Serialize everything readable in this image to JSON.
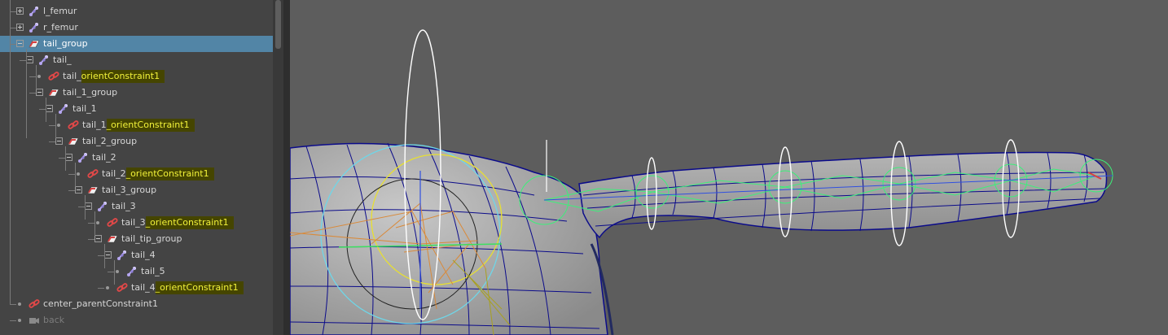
{
  "outliner": {
    "items": [
      {
        "name": "l_femur",
        "suffix": "",
        "icon": "joint-icon",
        "expander": "plus"
      },
      {
        "name": "r_femur",
        "suffix": "",
        "icon": "joint-icon",
        "expander": "plus"
      },
      {
        "name": "tail_group",
        "suffix": "",
        "icon": "transform-group-icon",
        "expander": "minus",
        "selected": true
      },
      {
        "name": "tail_",
        "suffix": "",
        "icon": "joint-icon",
        "expander": "minus"
      },
      {
        "name": "tail_",
        "suffix": "orientConstraint1",
        "icon": "constraint-icon",
        "expander": "none"
      },
      {
        "name": "tail_1_group",
        "suffix": "",
        "icon": "transform-group-icon",
        "expander": "minus"
      },
      {
        "name": "tail_1",
        "suffix": "",
        "icon": "joint-icon",
        "expander": "minus"
      },
      {
        "name": "tail_1",
        "suffix": "_orientConstraint1",
        "icon": "constraint-icon",
        "expander": "none"
      },
      {
        "name": "tail_2_group",
        "suffix": "",
        "icon": "transform-group-icon",
        "expander": "minus"
      },
      {
        "name": "tail_2",
        "suffix": "",
        "icon": "joint-icon",
        "expander": "minus"
      },
      {
        "name": "tail_2",
        "suffix": "_orientConstraint1",
        "icon": "constraint-icon",
        "expander": "none"
      },
      {
        "name": "tail_3_group",
        "suffix": "",
        "icon": "transform-group-icon",
        "expander": "minus"
      },
      {
        "name": "tail_3",
        "suffix": "",
        "icon": "joint-icon",
        "expander": "minus"
      },
      {
        "name": "tail_3",
        "suffix": "_orientConstraint1",
        "icon": "constraint-icon",
        "expander": "none"
      },
      {
        "name": "tail_tip_group",
        "suffix": "",
        "icon": "transform-group-icon",
        "expander": "minus"
      },
      {
        "name": "tail_4",
        "suffix": "",
        "icon": "joint-icon",
        "expander": "minus"
      },
      {
        "name": "tail_5",
        "suffix": "",
        "icon": "joint-icon",
        "expander": "none"
      },
      {
        "name": "tail_4",
        "suffix": "_orientConstraint1",
        "icon": "constraint-icon",
        "expander": "none"
      },
      {
        "name": "center_parentConstraint1",
        "suffix": "",
        "icon": "constraint-icon",
        "expander": "none"
      },
      {
        "name": "back",
        "suffix": "",
        "icon": "camera-icon",
        "expander": "none",
        "dim": true
      }
    ]
  },
  "colors": {
    "panel_bg": "#444444",
    "selection": "#5285a6",
    "highlight_bg": "#454500",
    "highlight_text": "#f2f23a",
    "viewport_bg": "#5d5d5d",
    "mesh_wire": "#0b0b8a",
    "joint_green": "#3cf07a",
    "control_curve": "#ffffff",
    "constraint_red": "#d94040",
    "joint_purple": "#b5a6f0"
  }
}
